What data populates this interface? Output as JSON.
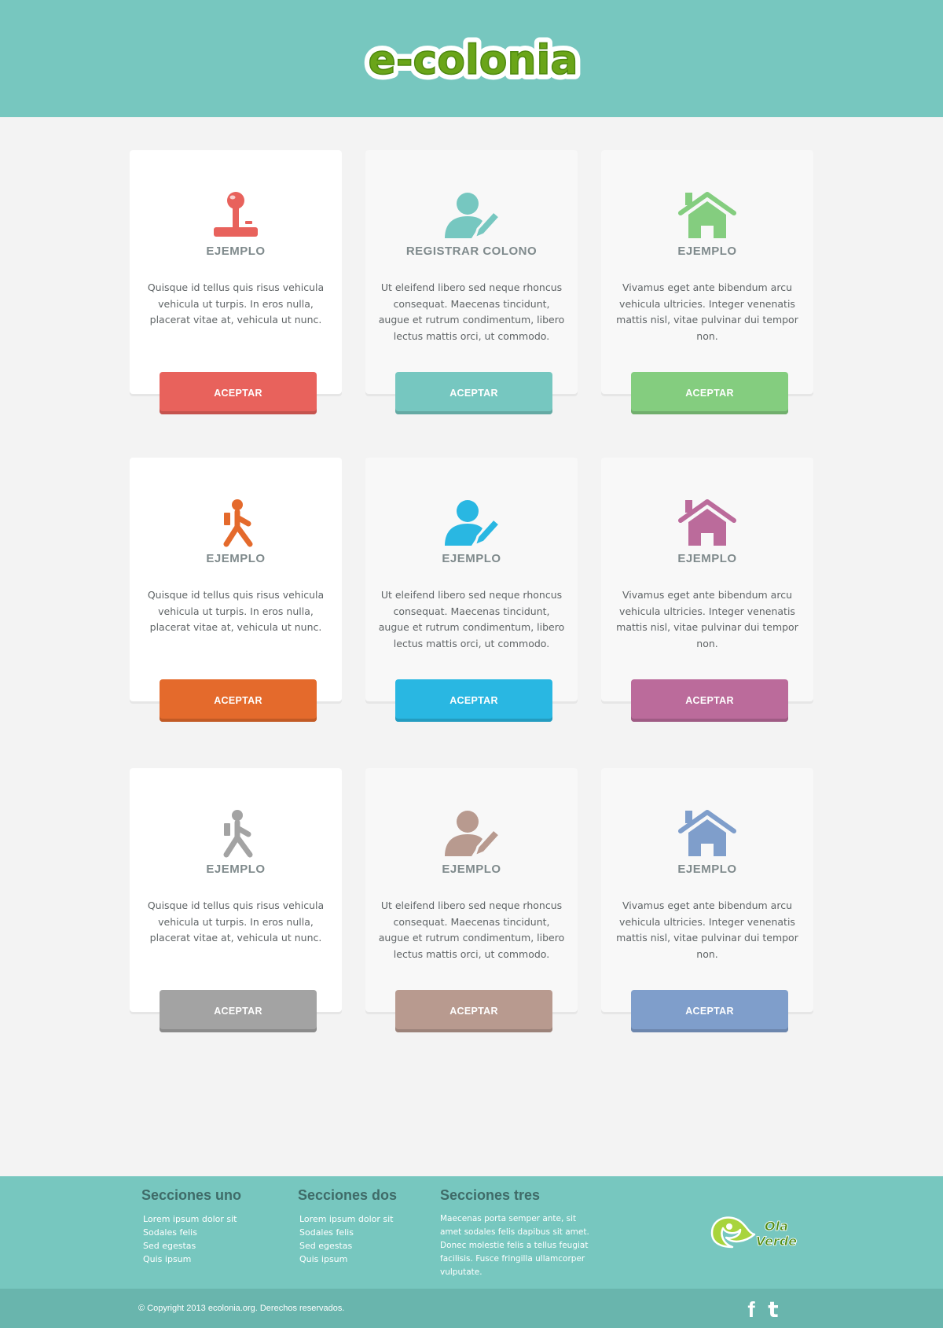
{
  "header": {
    "logo_text": "e-colonia"
  },
  "colors": {
    "header_bg": "#77c7bf",
    "page_bg": "#f3f3f3",
    "footer_bg": "#77c7bf",
    "bottombar_bg": "#69b5ad",
    "card_title": "#7f8a8c"
  },
  "cards": [
    {
      "icon": "joystick-icon",
      "title": "EJEMPLO",
      "text": "Quisque id tellus quis risus vehicula vehicula ut turpis. In eros nulla, placerat vitae at, vehicula ut nunc.",
      "button": "ACEPTAR",
      "color": "#e8625c"
    },
    {
      "icon": "user-edit-icon",
      "title": "REGISTRAR COLONO",
      "text": "Ut eleifend libero sed neque rhoncus consequat. Maecenas tincidunt, augue et rutrum condimentum, libero lectus mattis orci, ut commodo.",
      "button": "ACEPTAR",
      "color": "#76c7c0"
    },
    {
      "icon": "home-icon",
      "title": "EJEMPLO",
      "text": "Vivamus eget ante bibendum arcu vehicula ultricies. Integer venenatis mattis nisl, vitae pulvinar dui tempor non.",
      "button": "ACEPTAR",
      "color": "#84cd7f"
    },
    {
      "icon": "walking-person-icon",
      "title": "EJEMPLO",
      "text": "Quisque id tellus quis risus vehicula vehicula ut turpis. In eros nulla, placerat vitae at, vehicula ut nunc.",
      "button": "ACEPTAR",
      "color": "#e46a2c"
    },
    {
      "icon": "user-edit-icon",
      "title": "EJEMPLO",
      "text": "Ut eleifend libero sed neque rhoncus consequat. Maecenas tincidunt, augue et rutrum condimentum, libero lectus mattis orci, ut commodo.",
      "button": "ACEPTAR",
      "color": "#29b7e2"
    },
    {
      "icon": "home-icon",
      "title": "EJEMPLO",
      "text": "Vivamus eget ante bibendum arcu vehicula ultricies. Integer venenatis mattis nisl, vitae pulvinar dui tempor non.",
      "button": "ACEPTAR",
      "color": "#bb6b9b"
    },
    {
      "icon": "walking-person-icon",
      "title": "EJEMPLO",
      "text": "Quisque id tellus quis risus vehicula vehicula ut turpis. In eros nulla, placerat vitae at, vehicula ut nunc.",
      "button": "ACEPTAR",
      "color": "#a3a3a3"
    },
    {
      "icon": "user-edit-icon",
      "title": "EJEMPLO",
      "text": "Ut eleifend libero sed neque rhoncus consequat. Maecenas tincidunt, augue et rutrum condimentum, libero lectus mattis orci, ut commodo.",
      "button": "ACEPTAR",
      "color": "#b89a8f"
    },
    {
      "icon": "home-icon",
      "title": "EJEMPLO",
      "text": "Vivamus eget ante bibendum arcu vehicula ultricies. Integer venenatis mattis nisl, vitae pulvinar dui tempor non.",
      "button": "ACEPTAR",
      "color": "#7f9ecb"
    }
  ],
  "footer": {
    "col1": {
      "title": "Secciones uno",
      "items": [
        "Lorem ipsum dolor sit",
        "Sodales felis",
        "Sed egestas",
        "Quis ipsum"
      ]
    },
    "col2": {
      "title": "Secciones dos",
      "items": [
        "Lorem ipsum dolor sit",
        "Sodales felis",
        "Sed egestas",
        "Quis ipsum"
      ]
    },
    "col3": {
      "title": "Secciones tres",
      "text": "Maecenas porta semper ante, sit amet sodales felis dapibus sit amet. Donec molestie felis a tellus feugiat facilisis. Fusce fringilla ullamcorper vulputate."
    },
    "partner_logo": {
      "line1": "Ola",
      "line2": "Verde"
    }
  },
  "bottom": {
    "copyright": "© Copyright 2013 ecolonia.org. Derechos reservados.",
    "social": [
      {
        "icon": "facebook-icon",
        "glyph": "f"
      },
      {
        "icon": "twitter-icon",
        "glyph": "t"
      }
    ]
  }
}
